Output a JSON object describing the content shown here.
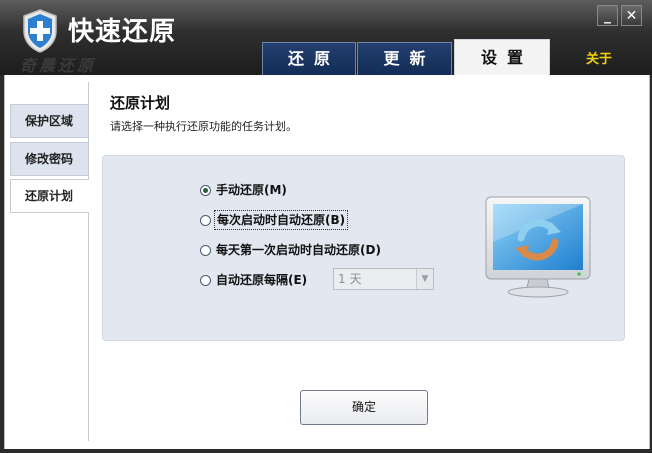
{
  "app": {
    "title": "快速还原",
    "brand_watermark": "奇晨还原"
  },
  "window_controls": {
    "minimize_label": "_",
    "close_label": "✕"
  },
  "tabs": [
    {
      "label": "还原",
      "active": false
    },
    {
      "label": "更新",
      "active": false
    },
    {
      "label": "设置",
      "active": true
    }
  ],
  "about_label": "关于",
  "sidebar": {
    "items": [
      {
        "label": "保护区域",
        "active": false
      },
      {
        "label": "修改密码",
        "active": false
      },
      {
        "label": "还原计划",
        "active": true
      }
    ]
  },
  "section": {
    "title": "还原计划",
    "description": "请选择一种执行还原功能的任务计划。"
  },
  "options": [
    {
      "label": "手动还原(M)",
      "checked": true
    },
    {
      "label": "每次启动时自动还原(B)",
      "checked": false
    },
    {
      "label": "每天第一次启动时自动还原(D)",
      "checked": false
    },
    {
      "label": "自动还原每隔(E)",
      "checked": false
    }
  ],
  "interval_select": {
    "value": "1 天",
    "disabled": true
  },
  "ok_button": "确定",
  "colors": {
    "tab_bg": "#132d57",
    "about": "#f0d200",
    "panel_bg": "#e2e7f0"
  }
}
